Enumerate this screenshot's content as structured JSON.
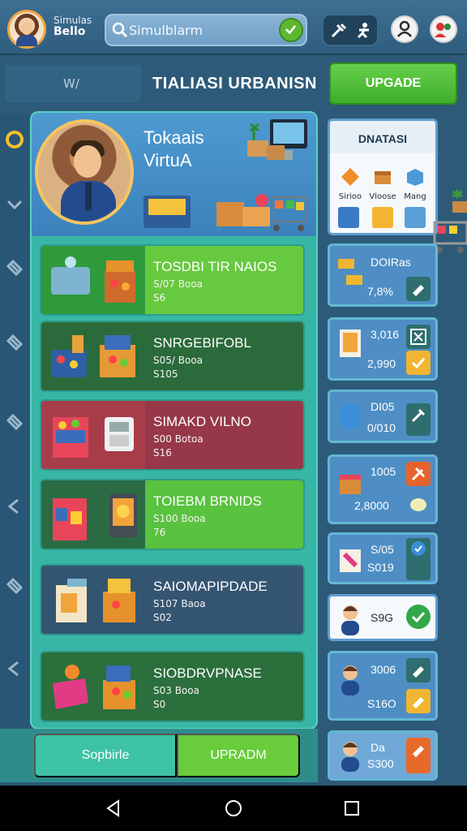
{
  "header": {
    "brand_line1": "Simulas",
    "brand_line2": "Bello",
    "search_placeholder": "Simulblarm",
    "icons": [
      "avatar",
      "search-icon",
      "go-arrow-icon",
      "tools-icon",
      "runner-icon",
      "profile-icon",
      "users-icon"
    ]
  },
  "subheader": {
    "left_text": "W/",
    "title": "TIALIASI URBANISN",
    "upgrade_label": "UPGADE"
  },
  "hero": {
    "title_line1": "Tokaais",
    "title_line2": "VirtuA"
  },
  "shops": [
    {
      "name": "TOSDBI TIR NAIOS",
      "price": "S/07 Booa",
      "count": "S6",
      "color_img": "#2e9a3c",
      "color_info": "#67c93f"
    },
    {
      "name": "SNRGEBIFOBL",
      "price": "S05/ Booa",
      "count": "S105",
      "color_img": "#2b6b3b",
      "color_info": "#2b6b3b"
    },
    {
      "name": "SIMAKD VILNO",
      "price": "S00 Botoa",
      "count": "S16",
      "color_img": "#a83d4a",
      "color_info": "#963847"
    },
    {
      "name": "TOIEBM BRNIDS",
      "price": "S100 Booa",
      "count": "76",
      "color_img": "#2a6b43",
      "color_info": "#59c23f"
    },
    {
      "name": "SAIOMAPIPDADE",
      "price": "S107 Baoa",
      "count": "S02",
      "color_img": "#345571",
      "color_info": "#345571"
    },
    {
      "name": "SIOBDRVPNASE",
      "price": "S03 Booa",
      "count": "S0",
      "color_img": "#2b6f3c",
      "color_info": "#2b6f3c"
    }
  ],
  "bottom": {
    "sort_label": "Sopbirle",
    "upgrade_label": "UPRADM"
  },
  "stats": {
    "title": "DNATASI",
    "labels": [
      "Sirioo",
      "Vloose",
      "Mang"
    ]
  },
  "right_cards": [
    {
      "v1": "DOIRas",
      "v2": "7,8%",
      "badge_color": "#2f6e6e"
    },
    {
      "v1": "3,016",
      "v2": "2,990",
      "badge_color": "#f1b531"
    },
    {
      "v1": "DI05",
      "v2": "0/010",
      "badge_color": "#2f6e6e"
    },
    {
      "v1": "1005",
      "v2": "2,8000",
      "badge_color": "#e8e8b0"
    },
    {
      "v1": "S/05",
      "v2": "S019",
      "badge_color": "#2f6e6e"
    },
    {
      "v1": "S9G",
      "v2": "",
      "badge_color": "#33a84a"
    },
    {
      "v1": "3006",
      "v2": "S16O",
      "badge_color": "#f1b531"
    },
    {
      "v1": "Da",
      "v2": "S300",
      "badge_color": "#e86a2b"
    }
  ],
  "colors": {
    "accent_green": "#5db830",
    "panel_teal": "#37b6a6",
    "background": "#2d5a78"
  }
}
